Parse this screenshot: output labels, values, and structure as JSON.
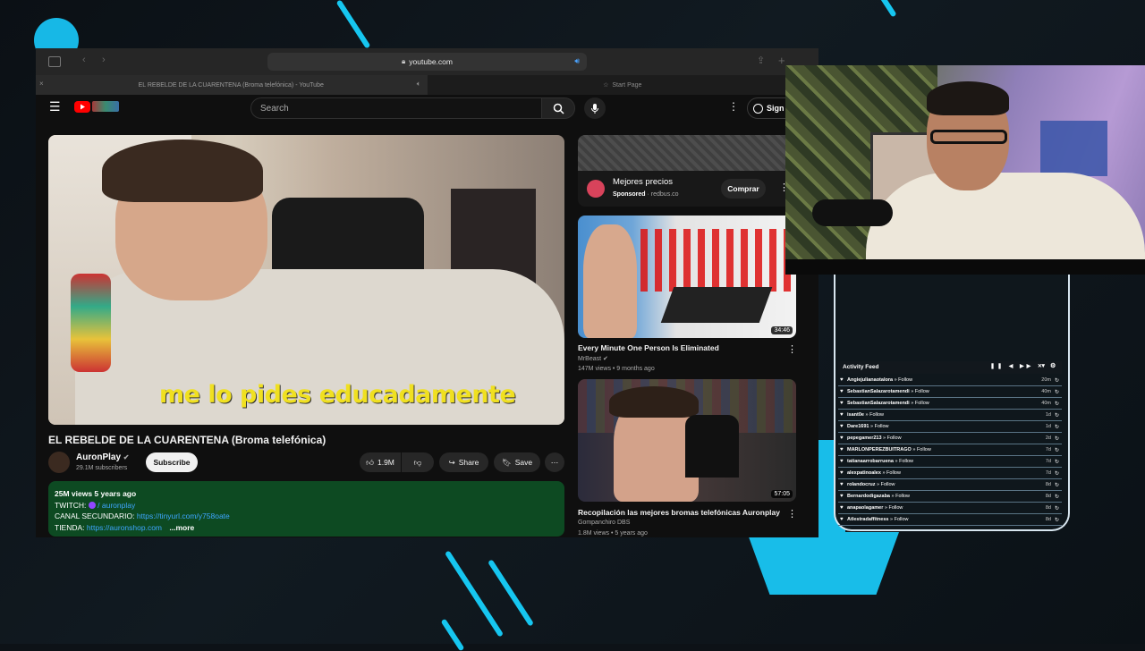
{
  "browser": {
    "url": "youtube.com",
    "tabs": [
      {
        "label": "EL REBELDE DE LA CUARENTENA (Broma telefónica) - YouTube"
      },
      {
        "label": "Start Page"
      }
    ]
  },
  "youtube": {
    "search_placeholder": "Search",
    "sign_in_label": "Sign",
    "video": {
      "caption": "me lo pides educadamente",
      "title": "EL REBELDE DE LA CUARENTENA (Broma telefónica)",
      "channel": "AuronPlay",
      "subscribers": "29.1M subscribers",
      "subscribe_label": "Subscribe",
      "likes": "1.9M",
      "share_label": "Share",
      "save_label": "Save"
    },
    "description": {
      "stats": "25M views  5 years ago",
      "twitch_label": "TWITCH:",
      "twitch_value": "/ auronplay",
      "canal_label": "CANAL SECUNDARIO:",
      "canal_link": "https://tinyurl.com/y758oate",
      "tienda_label": "TIENDA:",
      "tienda_link": "https://auronshop.com",
      "more_label": "...more"
    },
    "ad": {
      "title": "Mejores precios",
      "sponsored": "Sponsored",
      "domain": "redbus.co",
      "button": "Comprar"
    },
    "recommendations": [
      {
        "title": "Every Minute One Person Is Eliminated",
        "channel": "MrBeast",
        "meta": "147M views • 9 months ago",
        "duration": "34:46"
      },
      {
        "title": "Recopilación las mejores bromas telefónicas Auronplay",
        "channel": "Gompanchiro DBS",
        "meta": "1.8M views • 5 years ago",
        "duration": "57:05"
      }
    ]
  },
  "activity_feed": {
    "title": "Activity Feed",
    "rows": [
      {
        "name": "Angiejulianaotalora",
        "action": "Follow",
        "time": "20m"
      },
      {
        "name": "SebastianSalazarotamendi",
        "action": "Follow",
        "time": "40m"
      },
      {
        "name": "SebastianSalazarotamendi",
        "action": "Follow",
        "time": "40m"
      },
      {
        "name": "isant0e",
        "action": "Follow",
        "time": "1d"
      },
      {
        "name": "Dare1691",
        "action": "Follow",
        "time": "1d"
      },
      {
        "name": "pepegamer213",
        "action": "Follow",
        "time": "2d"
      },
      {
        "name": "MARLONPEREZBUITRAGO",
        "action": "Follow",
        "time": "7d"
      },
      {
        "name": "tatianaarrobarruena",
        "action": "Follow",
        "time": "7d"
      },
      {
        "name": "alexpatinoalex",
        "action": "Follow",
        "time": "7d"
      },
      {
        "name": "rolandocruz",
        "action": "Follow",
        "time": "8d"
      },
      {
        "name": "Bernardodigazaba",
        "action": "Follow",
        "time": "8d"
      },
      {
        "name": "anapaolagamer",
        "action": "Follow",
        "time": "8d"
      },
      {
        "name": "Atlestradaffitness",
        "action": "Follow",
        "time": "8d"
      }
    ]
  },
  "colors": {
    "accent": "#18bde9",
    "desc_bg": "#0d4a22",
    "yt_red": "#ff0000"
  }
}
